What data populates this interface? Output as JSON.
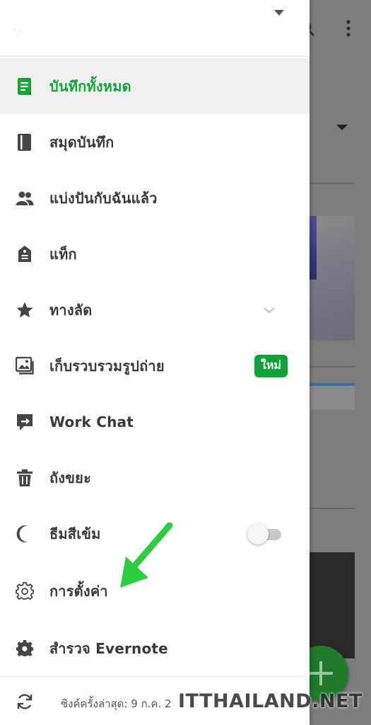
{
  "menu": {
    "items": [
      {
        "label": "บันทึกทั้งหมด",
        "icon": "note-icon",
        "active": true
      },
      {
        "label": "สมุดบันทึก",
        "icon": "notebook-icon"
      },
      {
        "label": "แบ่งปันกับฉันแล้ว",
        "icon": "shared-users-icon"
      },
      {
        "label": "แท็ก",
        "icon": "tag-icon"
      },
      {
        "label": "ทางลัด",
        "icon": "star-icon"
      },
      {
        "label": "เก็บรวบรวมรูปถ่าย",
        "icon": "photo-gallery-icon"
      },
      {
        "label": "Work Chat",
        "icon": "work-chat-icon"
      },
      {
        "label": "ถังขยะ",
        "icon": "trash-icon"
      },
      {
        "label": "ธีมสีเข้ม",
        "icon": "moon-icon"
      },
      {
        "label": "การตั้งค่า",
        "icon": "settings-gear-outline-icon"
      },
      {
        "label": "สำรวจ Evernote",
        "icon": "gear-filled-icon"
      }
    ],
    "new_badge": "ใหม่",
    "dark_theme_enabled": false
  },
  "footer": {
    "sync_text": "ซิงค์ครั้งล่าสุด: 9 ก.ค. 2"
  },
  "watermark": "ITTHAILAND.NET",
  "colors": {
    "accent": "#14a338",
    "badge": "#12a03a",
    "annotation_arrow": "#2ecc40"
  }
}
